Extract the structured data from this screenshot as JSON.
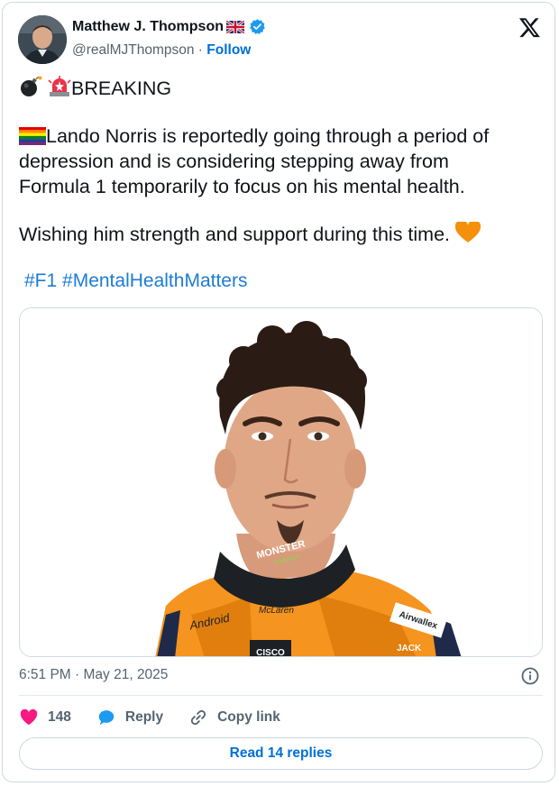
{
  "author": {
    "name": "Matthew J. Thompson",
    "handle": "@realMJThompson",
    "separator": "·",
    "follow_label": "Follow"
  },
  "tweet": {
    "line1": "BREAKING",
    "line2": "Lando Norris is reportedly going through a period of",
    "line3": "depression and is considering stepping away from",
    "line4": "Formula 1 temporarily to focus on his mental health.",
    "line5": "Wishing him strength and support during this time.",
    "hashtag1": "#F1",
    "hashtag2": "#MentalHealthMatters"
  },
  "media": {
    "patches": {
      "collar": "MONSTER",
      "collar_sub": "ENERGY",
      "sponsor_left": "Android",
      "sponsor_center": "McLaren",
      "sponsor_right": "Airwallex",
      "sponsor_bottom": "CISCO",
      "sponsor_bottom_right": "JACK"
    }
  },
  "timestamp": "6:51 PM · May 21, 2025",
  "actions": {
    "like_count": "148",
    "reply_label": "Reply",
    "copy_label": "Copy link"
  },
  "read_replies_label": "Read 14 replies",
  "colors": {
    "link": "#1d7bd4",
    "follow": "#006fd6",
    "heart": "#f91880",
    "reply_bubble": "#1d9bf0",
    "suit_orange": "#f5941f"
  },
  "icons": [
    "bomb-icon",
    "siren-icon",
    "rainbow-flag-icon",
    "orange-heart-icon",
    "uk-flag-icon",
    "verified-badge-icon",
    "x-logo-icon",
    "info-icon",
    "heart-icon",
    "reply-bubble-icon",
    "link-icon"
  ]
}
